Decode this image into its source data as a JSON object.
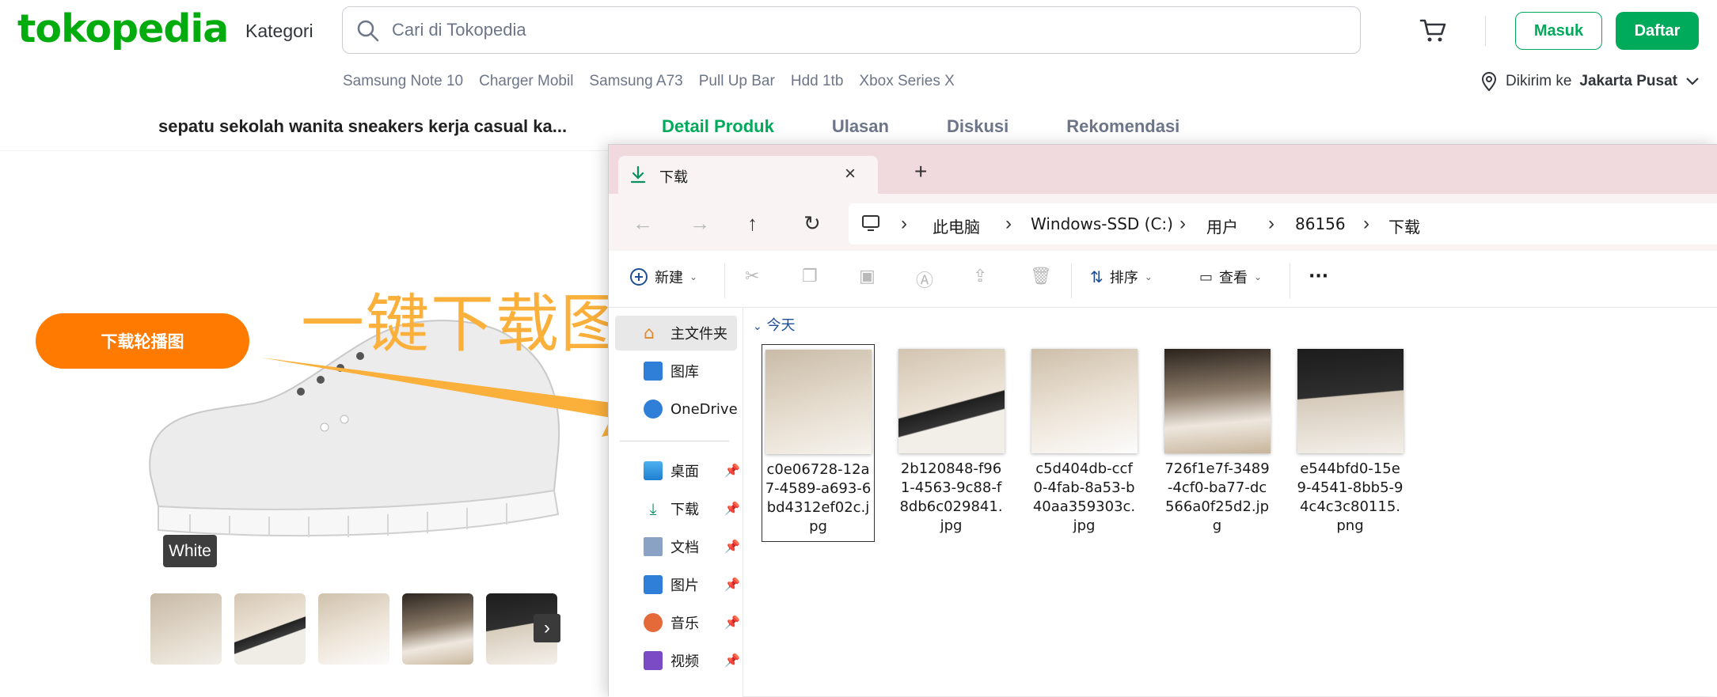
{
  "header": {
    "logo": "tokopedia",
    "kategori": "Kategori",
    "search_placeholder": "Cari di Tokopedia",
    "login": "Masuk",
    "register": "Daftar",
    "quick_links": [
      "Samsung Note 10",
      "Charger Mobil",
      "Samsung A73",
      "Pull Up Bar",
      "Hdd 1tb",
      "Xbox Series X"
    ],
    "location_prefix": "Dikirim ke",
    "location_city": "Jakarta Pusat"
  },
  "product_bar": {
    "title": "sepatu sekolah wanita sneakers kerja casual ka...",
    "tabs": [
      "Detail Produk",
      "Ulasan",
      "Diskusi",
      "Rekomendasi"
    ],
    "active_tab": "Detail Produk"
  },
  "promo": {
    "download_button": "下载轮播图",
    "headline": "一键下载图片",
    "variant_badge": "White"
  },
  "explorer": {
    "tab_title": "下载",
    "breadcrumb": [
      "此电脑",
      "Windows-SSD (C:)",
      "用户",
      "86156",
      "下载"
    ],
    "toolbar": {
      "new": "新建",
      "sort": "排序",
      "view": "查看"
    },
    "sidebar": [
      {
        "label": "主文件夹",
        "icon": "home-icon",
        "pinned": false
      },
      {
        "label": "图库",
        "icon": "gallery-icon",
        "pinned": false
      },
      {
        "label": "OneDrive",
        "icon": "onedrive-icon",
        "pinned": false
      },
      {
        "label": "桌面",
        "icon": "desktop-icon",
        "pinned": true
      },
      {
        "label": "下载",
        "icon": "download-icon",
        "pinned": true
      },
      {
        "label": "文档",
        "icon": "documents-icon",
        "pinned": true
      },
      {
        "label": "图片",
        "icon": "pictures-icon",
        "pinned": true
      },
      {
        "label": "音乐",
        "icon": "music-icon",
        "pinned": true
      },
      {
        "label": "视频",
        "icon": "videos-icon",
        "pinned": true
      }
    ],
    "group_label": "今天",
    "files": [
      "c0e06728-12a7-4589-a693-6bd4312ef02c.jpg",
      "2b120848-f961-4563-9c88-f8db6c029841.jpg",
      "c5d404db-ccf0-4fab-8a53-b40aa359303c.jpg",
      "726f1e7f-3489-4cf0-ba77-dc566a0f25d2.jpg",
      "e544bfd0-15e9-4541-8bb5-94c4c3c80115.png"
    ]
  },
  "colors": {
    "brand_green": "#03ac0e",
    "button_green": "#00aa5b",
    "orange_button": "#ff7a00",
    "headline_yellow": "#fbb03b"
  }
}
